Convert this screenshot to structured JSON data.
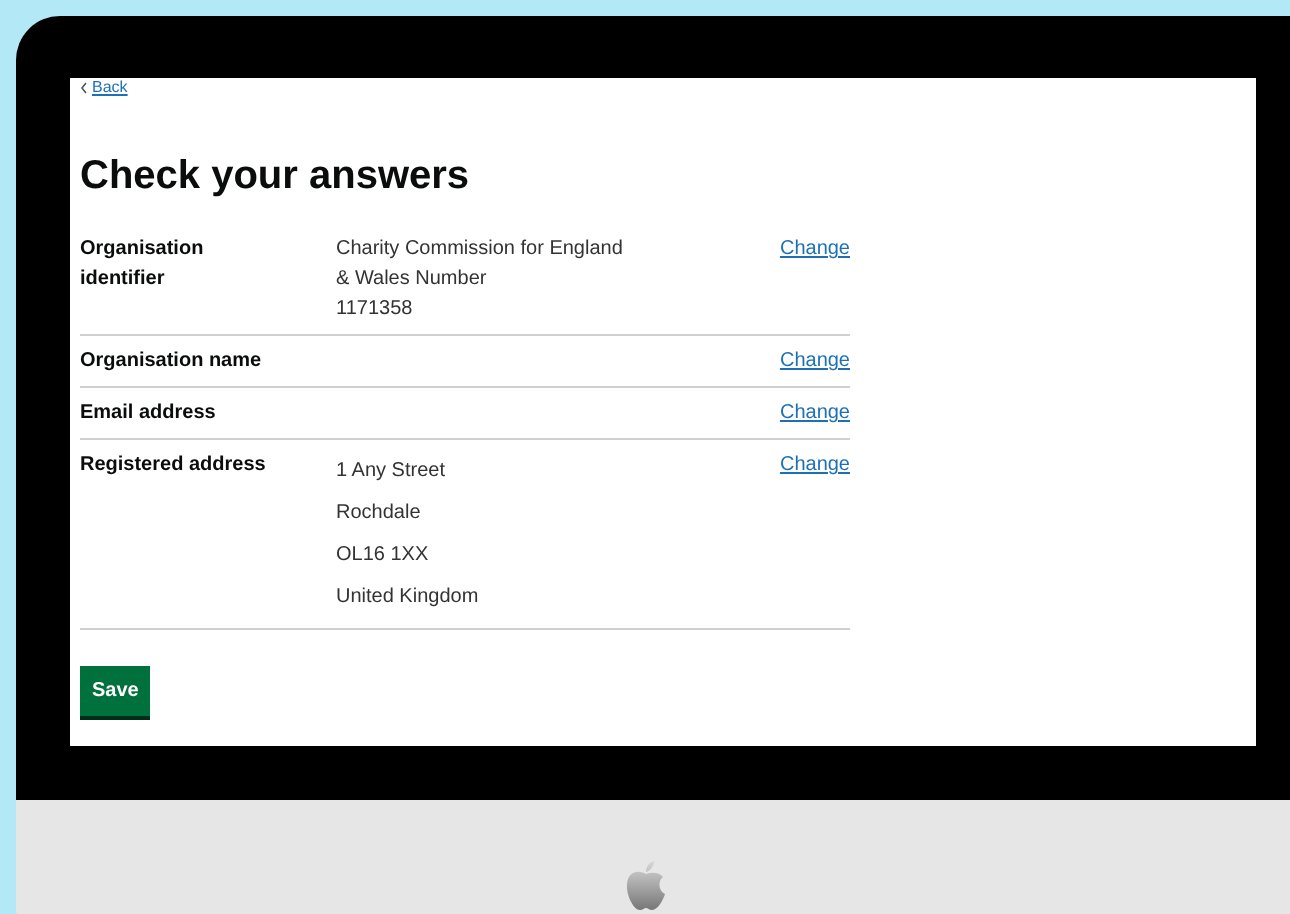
{
  "back_link": "Back",
  "heading": "Check your answers",
  "rows": [
    {
      "key": "Organisation identifier",
      "values": [
        "Charity Commission for England & Wales Number",
        "1171358"
      ],
      "action": "Change"
    },
    {
      "key": "Organisation name",
      "values": [],
      "action": "Change"
    },
    {
      "key": "Email address",
      "values": [],
      "action": "Change"
    },
    {
      "key": "Registered address",
      "values": [
        "1 Any Street",
        "Rochdale",
        "OL16 1XX",
        "United Kingdom"
      ],
      "action": "Change"
    }
  ],
  "save_button": "Save"
}
